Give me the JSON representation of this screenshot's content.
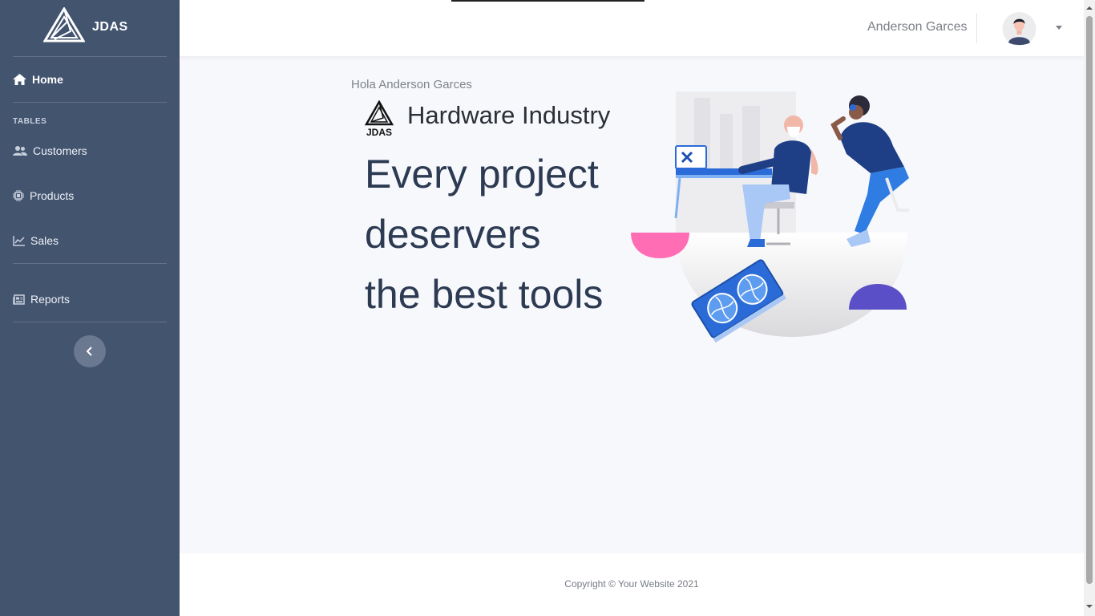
{
  "brand": {
    "name": "JDAS"
  },
  "sidebar": {
    "home": {
      "label": "Home",
      "icon": "home-icon"
    },
    "section_heading": "TABLES",
    "items": [
      {
        "label": "Customers",
        "icon": "users-icon"
      },
      {
        "label": "Products",
        "icon": "chip-icon"
      },
      {
        "label": "Sales",
        "icon": "chart-line-icon"
      },
      {
        "label": "Reports",
        "icon": "newspaper-icon"
      }
    ],
    "collapse_icon": "chevron-left-icon"
  },
  "topbar": {
    "user_name": "Anderson Garces",
    "caret_icon": "caret-down-icon"
  },
  "main": {
    "greeting": "Hola Anderson Garces",
    "logo_text": "JDAS",
    "industry": "Hardware Industry",
    "tagline_lines": [
      "Every project",
      "deservers",
      "the best tools"
    ]
  },
  "footer": {
    "copyright": "Copyright © Your Website 2021"
  },
  "colors": {
    "sidebar_bg": "#43546f",
    "accent_pink": "#ff6eb4",
    "accent_purple": "#5b4fc7",
    "accent_blue": "#2a6bd8"
  }
}
